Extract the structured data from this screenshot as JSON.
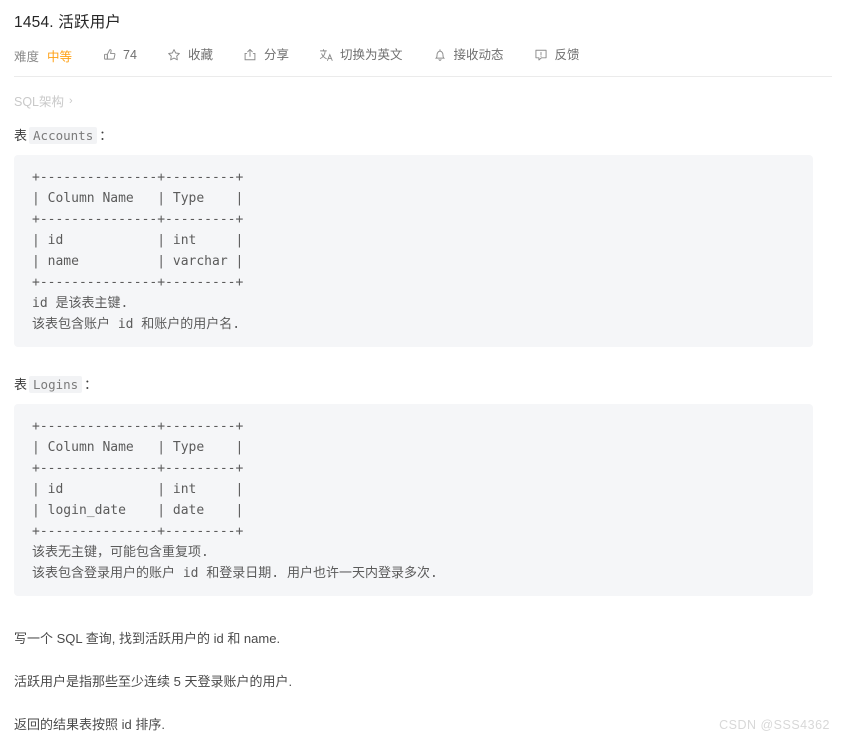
{
  "header": {
    "title": "1454. 活跃用户"
  },
  "toolbar": {
    "difficulty_label": "难度",
    "difficulty_value": "中等",
    "difficulty_color": "#ffa116",
    "items": [
      {
        "icon": "thumbs-up-icon",
        "label": "74"
      },
      {
        "icon": "star-icon",
        "label": "收藏"
      },
      {
        "icon": "share-icon",
        "label": "分享"
      },
      {
        "icon": "translate-icon",
        "label": "切换为英文"
      },
      {
        "icon": "bell-icon",
        "label": "接收动态"
      },
      {
        "icon": "feedback-icon",
        "label": "反馈"
      }
    ]
  },
  "breadcrumb": {
    "label": "SQL架构",
    "chevron": "›"
  },
  "content": {
    "table_accounts": {
      "caption_prefix": "表",
      "caption_code": "Accounts",
      "caption_suffix": "：",
      "code": "+---------------+---------+\n| Column Name   | Type    |\n+---------------+---------+\n| id            | int     |\n| name          | varchar |\n+---------------+---------+",
      "notes": [
        "id 是该表主键.",
        "该表包含账户 id 和账户的用户名."
      ]
    },
    "table_logins": {
      "caption_prefix": "表",
      "caption_code": "Logins",
      "caption_suffix": "：",
      "code": "+---------------+---------+\n| Column Name   | Type    |\n+---------------+---------+\n| id            | int     |\n| login_date    | date    |\n+---------------+---------+",
      "notes": [
        "该表无主键，可能包含重复项.",
        "该表包含登录用户的账户 id 和登录日期. 用户也许一天内登录多次."
      ]
    },
    "paragraphs": [
      "写一个 SQL 查询, 找到活跃用户的 id 和 name.",
      "活跃用户是指那些至少连续 5 天登录账户的用户.",
      "返回的结果表按照 id 排序."
    ]
  },
  "watermark": {
    "text": "CSDN @SSS4362"
  }
}
